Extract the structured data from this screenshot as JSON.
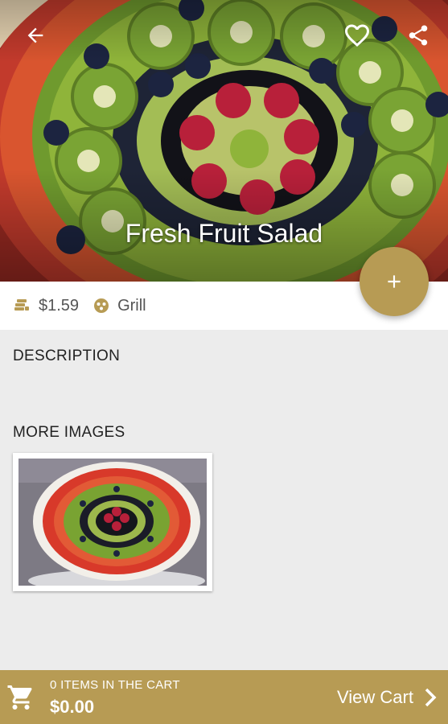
{
  "product": {
    "title": "Fresh Fruit Salad",
    "price": "$1.59",
    "category": "Grill"
  },
  "sections": {
    "description_label": "DESCRIPTION",
    "description_text": "",
    "more_images_label": "MORE IMAGES"
  },
  "cart": {
    "items_text": "0 ITEMS IN THE CART",
    "total": "$0.00",
    "view_label": "View Cart"
  },
  "icons": {
    "back": "arrow-left-icon",
    "favorite": "heart-outline-icon",
    "share": "share-icon",
    "add": "plus-icon",
    "price": "coins-icon",
    "category": "grill-icon",
    "cart": "cart-icon",
    "view_cart": "chevron-right-icon"
  },
  "colors": {
    "accent": "#b79b54",
    "background": "#ececec"
  }
}
